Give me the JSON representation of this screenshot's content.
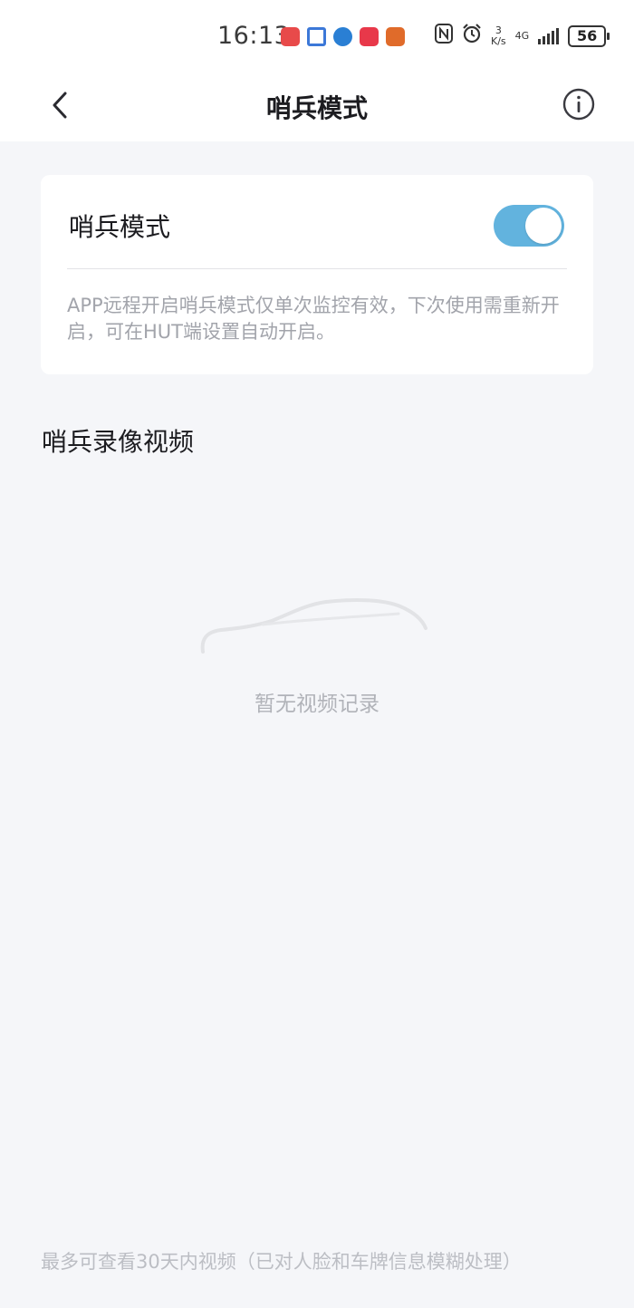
{
  "status_bar": {
    "time": "16:13",
    "net_speed_value": "3",
    "net_speed_unit": "K/s",
    "network_type": "4G",
    "battery": "56",
    "app_icons": [
      "#e84a4a",
      "#3c78d8",
      "#2a7fd4",
      "#e8384a",
      "#e06b2a"
    ]
  },
  "nav": {
    "title": "哨兵模式"
  },
  "sentry_card": {
    "label": "哨兵模式",
    "toggle_on": true,
    "description": "APP远程开启哨兵模式仅单次监控有效，下次使用需重新开启，可在HUT端设置自动开启。"
  },
  "videos": {
    "section_title": "哨兵录像视频",
    "empty_text": "暂无视频记录"
  },
  "footer": {
    "note": "最多可查看30天内视频（已对人脸和车牌信息模糊处理）"
  },
  "colors": {
    "accent": "#62b3de",
    "background": "#f5f6f9",
    "muted_text": "#a2a4ab"
  }
}
